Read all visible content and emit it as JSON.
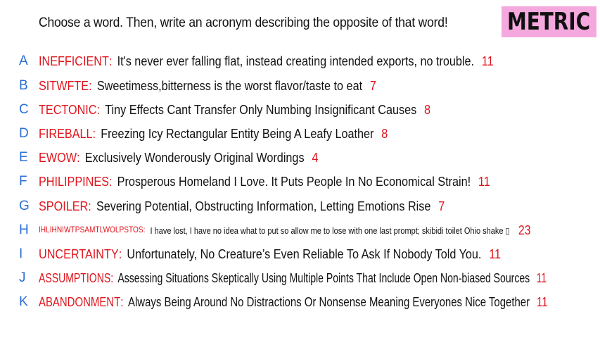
{
  "prompt": "Choose a word. Then, write an acronym describing the opposite of that word!",
  "badge": "METRIC",
  "colors": {
    "letter": "#2b6fd6",
    "word": "#e0141c",
    "score": "#e0141c",
    "badge_bg": "#f5a8de"
  },
  "rows": [
    {
      "letter": "A",
      "word": "INEFFICIENT",
      "definition": "It's never ever falling flat, instead creating intended exports, no trouble.",
      "score": "11"
    },
    {
      "letter": "B",
      "word": "SITWFTE",
      "definition": "Sweetimess,bitterness is the worst flavor/taste to eat",
      "score": "7"
    },
    {
      "letter": "C",
      "word": "TECTONIC",
      "definition": "Tiny Effects Cant Transfer Only Numbing Insignificant Causes",
      "score": "8"
    },
    {
      "letter": "D",
      "word": "FIREBALL",
      "definition": "Freezing Icy Rectangular Entity Being A Leafy Loather",
      "score": "8"
    },
    {
      "letter": "E",
      "word": "EWOW",
      "definition": "Exclusively Wonderously Original Wordings",
      "score": "4"
    },
    {
      "letter": "F",
      "word": "PHILIPPINES",
      "definition": "Prosperous Homeland I Love. It Puts People In No Economical Strain!",
      "score": "11"
    },
    {
      "letter": "G",
      "word": "SPOILER",
      "definition": "Severing Potential, Obstructing Information, Letting Emotions Rise",
      "score": "7"
    },
    {
      "letter": "H",
      "word": "IHLIHNIWTPSAMTLWOLPSTOS",
      "definition": "I have lost, I have no idea what to put so allow me to lose with one last prompt; skibidi toilet Ohio shake ▯",
      "score": "23"
    },
    {
      "letter": "I",
      "word": "UNCERTAINTY",
      "definition": "Unfortunately, No Creature’s Even Reliable To Ask If Nobody Told You.",
      "score": "11"
    },
    {
      "letter": "J",
      "word": "ASSUMPTIONS",
      "definition": "Assessing Situations Skeptically Using Multiple Points That Include Open Non-biased Sources",
      "score": "11"
    },
    {
      "letter": "K",
      "word": "ABANDONMENT",
      "definition": "Always Being Around No Distractions Or Nonsense Meaning Everyones Nice Together",
      "score": "11"
    }
  ]
}
